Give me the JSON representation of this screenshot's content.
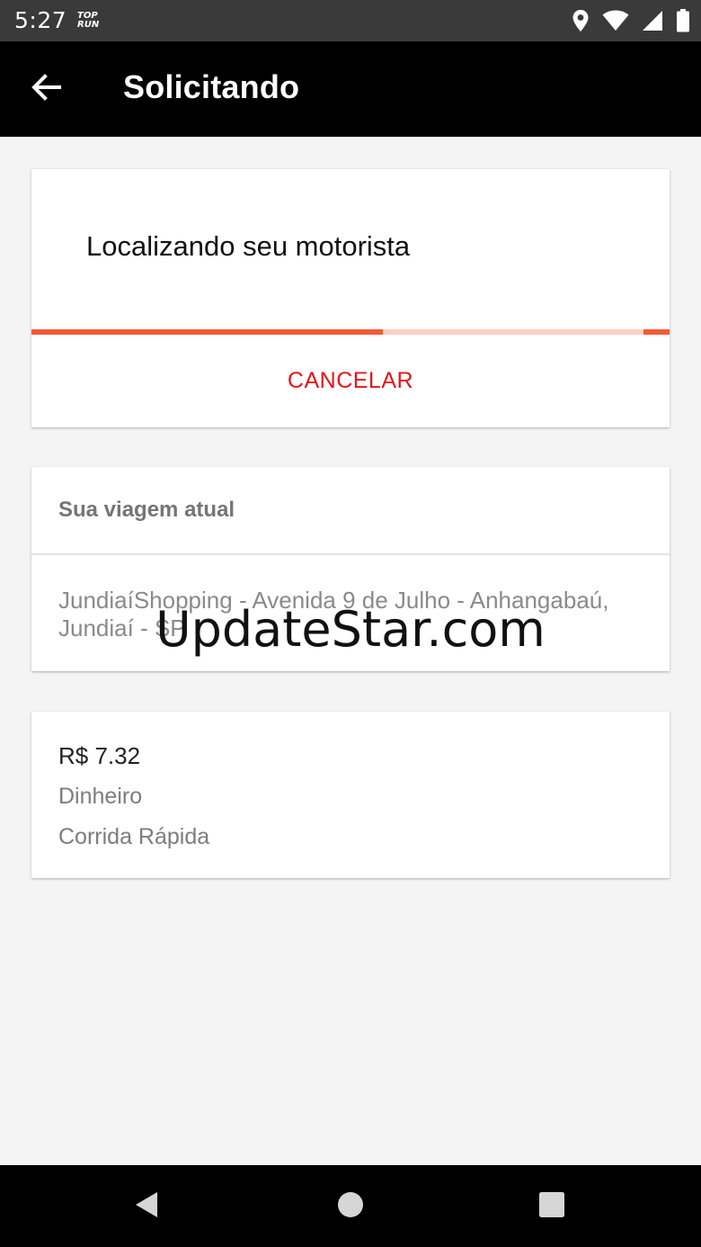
{
  "status_bar": {
    "time": "5:27",
    "app_icon_text": "TOP RUN",
    "icons": [
      "location-icon",
      "wifi-icon",
      "signal-icon",
      "battery-icon"
    ]
  },
  "app_bar": {
    "back_icon": "arrow-back-icon",
    "title": "Solicitando"
  },
  "status_card": {
    "message": "Localizando seu motorista",
    "progress_fraction": 0.55,
    "cancel_label": "CANCELAR"
  },
  "trip_card": {
    "header": "Sua viagem atual",
    "address": "JundiaíShopping - Avenida 9 de Julho - Anhangabaú, Jundiaí - SP"
  },
  "payment_card": {
    "fare": "R$ 7.32",
    "method": "Dinheiro",
    "ride_type": "Corrida Rápida"
  },
  "watermark": "UpdateStar.com",
  "nav_bar": {
    "icons": [
      "back-triangle-icon",
      "home-circle-icon",
      "recents-square-icon"
    ]
  },
  "colors": {
    "accent": "#f65a35",
    "accent_light": "#fbd0c5",
    "cancel": "#e8141b",
    "app_bar": "#000000",
    "background": "#f5f4f5"
  }
}
